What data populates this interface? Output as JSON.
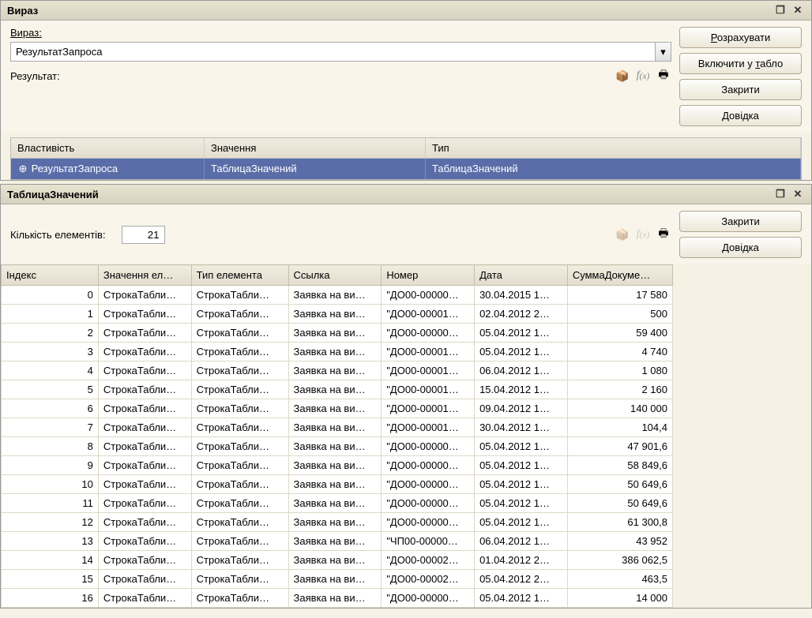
{
  "top_window": {
    "title": "Вираз",
    "expression_label": "Вираз:",
    "expression_value": "РезультатЗапроса",
    "result_label": "Результат:",
    "buttons": {
      "calculate": "Розрахувати",
      "include": "Включити у табло",
      "close": "Закрити",
      "help": "Довідка"
    },
    "property_table": {
      "headers": {
        "property": "Властивість",
        "value": "Значення",
        "type": "Тип"
      },
      "row": {
        "property": "РезультатЗапроса",
        "value": "ТаблицаЗначений",
        "type": "ТаблицаЗначений"
      }
    }
  },
  "bottom_window": {
    "title": "ТаблицаЗначений",
    "count_label": "Кількість елементів:",
    "count_value": "21",
    "buttons": {
      "close": "Закрити",
      "help": "Довідка"
    },
    "columns": {
      "index": "Індекс",
      "value": "Значення ел…",
      "type": "Тип елемента",
      "link": "Ссылка",
      "number": "Номер",
      "date": "Дата",
      "sum": "СуммаДокуме…"
    },
    "rows": [
      {
        "idx": "0",
        "val": "СтрокаТабли…",
        "typ": "СтрокаТабли…",
        "link": "Заявка на ви…",
        "num": "\"ДО00-00000…",
        "date": "30.04.2015 1…",
        "sum": "17 580"
      },
      {
        "idx": "1",
        "val": "СтрокаТабли…",
        "typ": "СтрокаТабли…",
        "link": "Заявка на ви…",
        "num": "\"ДО00-00001…",
        "date": "02.04.2012 2…",
        "sum": "500"
      },
      {
        "idx": "2",
        "val": "СтрокаТабли…",
        "typ": "СтрокаТабли…",
        "link": "Заявка на ви…",
        "num": "\"ДО00-00000…",
        "date": "05.04.2012 1…",
        "sum": "59 400"
      },
      {
        "idx": "3",
        "val": "СтрокаТабли…",
        "typ": "СтрокаТабли…",
        "link": "Заявка на ви…",
        "num": "\"ДО00-00001…",
        "date": "05.04.2012 1…",
        "sum": "4 740"
      },
      {
        "idx": "4",
        "val": "СтрокаТабли…",
        "typ": "СтрокаТабли…",
        "link": "Заявка на ви…",
        "num": "\"ДО00-00001…",
        "date": "06.04.2012 1…",
        "sum": "1 080"
      },
      {
        "idx": "5",
        "val": "СтрокаТабли…",
        "typ": "СтрокаТабли…",
        "link": "Заявка на ви…",
        "num": "\"ДО00-00001…",
        "date": "15.04.2012 1…",
        "sum": "2 160"
      },
      {
        "idx": "6",
        "val": "СтрокаТабли…",
        "typ": "СтрокаТабли…",
        "link": "Заявка на ви…",
        "num": "\"ДО00-00001…",
        "date": "09.04.2012 1…",
        "sum": "140 000"
      },
      {
        "idx": "7",
        "val": "СтрокаТабли…",
        "typ": "СтрокаТабли…",
        "link": "Заявка на ви…",
        "num": "\"ДО00-00001…",
        "date": "30.04.2012 1…",
        "sum": "104,4"
      },
      {
        "idx": "8",
        "val": "СтрокаТабли…",
        "typ": "СтрокаТабли…",
        "link": "Заявка на ви…",
        "num": "\"ДО00-00000…",
        "date": "05.04.2012 1…",
        "sum": "47 901,6"
      },
      {
        "idx": "9",
        "val": "СтрокаТабли…",
        "typ": "СтрокаТабли…",
        "link": "Заявка на ви…",
        "num": "\"ДО00-00000…",
        "date": "05.04.2012 1…",
        "sum": "58 849,6"
      },
      {
        "idx": "10",
        "val": "СтрокаТабли…",
        "typ": "СтрокаТабли…",
        "link": "Заявка на ви…",
        "num": "\"ДО00-00000…",
        "date": "05.04.2012 1…",
        "sum": "50 649,6"
      },
      {
        "idx": "11",
        "val": "СтрокаТабли…",
        "typ": "СтрокаТабли…",
        "link": "Заявка на ви…",
        "num": "\"ДО00-00000…",
        "date": "05.04.2012 1…",
        "sum": "50 649,6"
      },
      {
        "idx": "12",
        "val": "СтрокаТабли…",
        "typ": "СтрокаТабли…",
        "link": "Заявка на ви…",
        "num": "\"ДО00-00000…",
        "date": "05.04.2012 1…",
        "sum": "61 300,8"
      },
      {
        "idx": "13",
        "val": "СтрокаТабли…",
        "typ": "СтрокаТабли…",
        "link": "Заявка на ви…",
        "num": "\"ЧП00-00000…",
        "date": "06.04.2012 1…",
        "sum": "43 952"
      },
      {
        "idx": "14",
        "val": "СтрокаТабли…",
        "typ": "СтрокаТабли…",
        "link": "Заявка на ви…",
        "num": "\"ДО00-00002…",
        "date": "01.04.2012 2…",
        "sum": "386 062,5"
      },
      {
        "idx": "15",
        "val": "СтрокаТабли…",
        "typ": "СтрокаТабли…",
        "link": "Заявка на ви…",
        "num": "\"ДО00-00002…",
        "date": "05.04.2012 2…",
        "sum": "463,5"
      },
      {
        "idx": "16",
        "val": "СтрокаТабли…",
        "typ": "СтрокаТабли…",
        "link": "Заявка на ви…",
        "num": "\"ДО00-00000…",
        "date": "05.04.2012 1…",
        "sum": "14 000"
      }
    ]
  }
}
